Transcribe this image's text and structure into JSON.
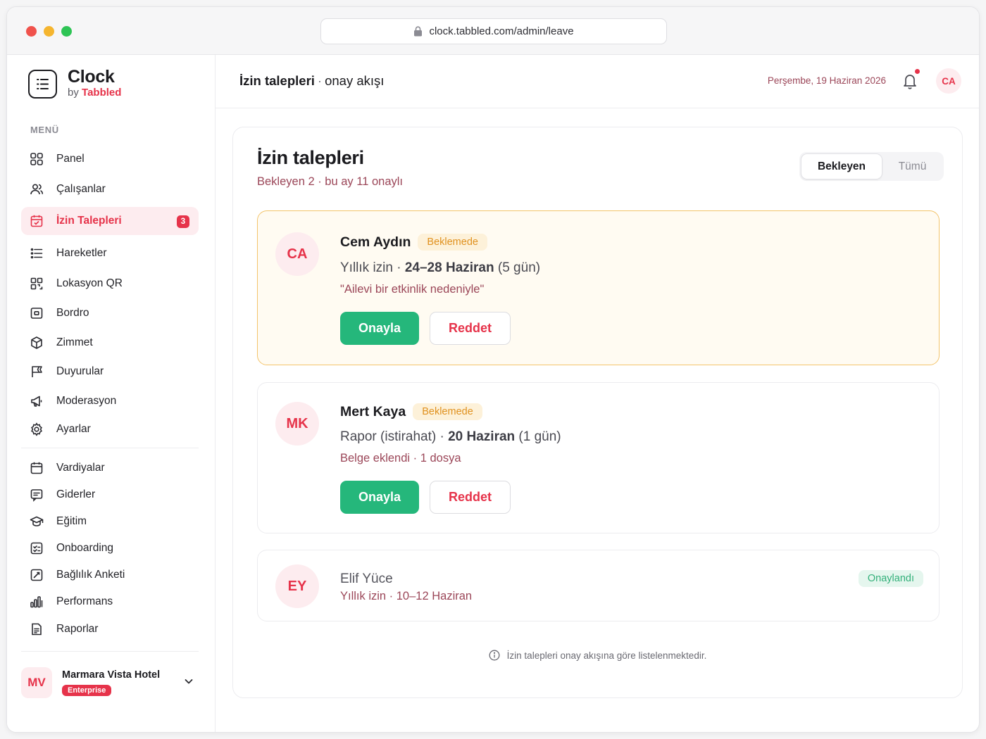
{
  "browser": {
    "url": "clock.tabbled.com/admin/leave"
  },
  "brand": {
    "name": "Clock",
    "by": "by",
    "company": "Tabbled"
  },
  "sidebar": {
    "menu_label": "MENÜ",
    "items": [
      {
        "label": "Panel",
        "icon": "grid-icon"
      },
      {
        "label": "Çalışanlar",
        "icon": "users-icon"
      },
      {
        "label": "İzin Talepleri",
        "icon": "calendar-icon",
        "active": true,
        "badge": "3"
      },
      {
        "label": "Hareketler",
        "icon": "list-icon"
      },
      {
        "label": "Lokasyon QR",
        "icon": "qr-icon"
      },
      {
        "label": "Bordro",
        "icon": "money-icon"
      },
      {
        "label": "Zimmet",
        "icon": "box-icon"
      },
      {
        "label": "Duyurular",
        "icon": "flag-icon"
      },
      {
        "label": "Moderasyon",
        "icon": "megaphone-icon"
      },
      {
        "label": "Ayarlar",
        "icon": "gear-icon"
      },
      {
        "label": "Vardiyalar",
        "icon": "calendar-icon"
      },
      {
        "label": "Giderler",
        "icon": "receipt-icon"
      },
      {
        "label": "Eğitim",
        "icon": "graduation-icon"
      },
      {
        "label": "Onboarding",
        "icon": "checklist-icon"
      },
      {
        "label": "Bağlılık Anketi",
        "icon": "survey-icon"
      },
      {
        "label": "Performans",
        "icon": "bar-chart-icon"
      },
      {
        "label": "Raporlar",
        "icon": "report-icon"
      }
    ],
    "org": {
      "initials": "MV",
      "name": "Marmara Vista Hotel",
      "plan": "Enterprise"
    }
  },
  "header": {
    "title": "İzin talepleri",
    "separator": "·",
    "subtitle": "onay akışı",
    "date": "Perşembe, 19 Haziran 2026",
    "user_initials": "CA"
  },
  "main": {
    "title": "İzin talepleri",
    "subtitle": "Bekleyen 2 · bu ay 11 onaylı",
    "filters": {
      "pending": "Bekleyen",
      "all": "Tümü"
    },
    "requests": [
      {
        "initials": "CA",
        "name": "Cem Aydın",
        "status": "Beklemede",
        "type": "Yıllık izin · ",
        "range": "24–28 Haziran",
        "days": " (5 gün)",
        "note": "\"Ailevi bir etkinlik nedeniyle\"",
        "approve": "Onayla",
        "reject": "Reddet"
      },
      {
        "initials": "MK",
        "name": "Mert Kaya",
        "status": "Beklemede",
        "type": "Rapor (istirahat) · ",
        "range": "20 Haziran",
        "days": " (1 gün)",
        "note": "Belge eklendi · 1 dosya",
        "approve": "Onayla",
        "reject": "Reddet"
      },
      {
        "initials": "EY",
        "name": "Elif Yüce",
        "status": "Onaylandı",
        "note": "Yıllık izin · 10–12 Haziran"
      }
    ],
    "footer_note": "İzin talepleri onay akışına göre listelenmektedir."
  },
  "colors": {
    "accent": "#e6334a",
    "success": "#25b77b",
    "pending": "#e0911f",
    "muted_rose": "#9b4658"
  }
}
